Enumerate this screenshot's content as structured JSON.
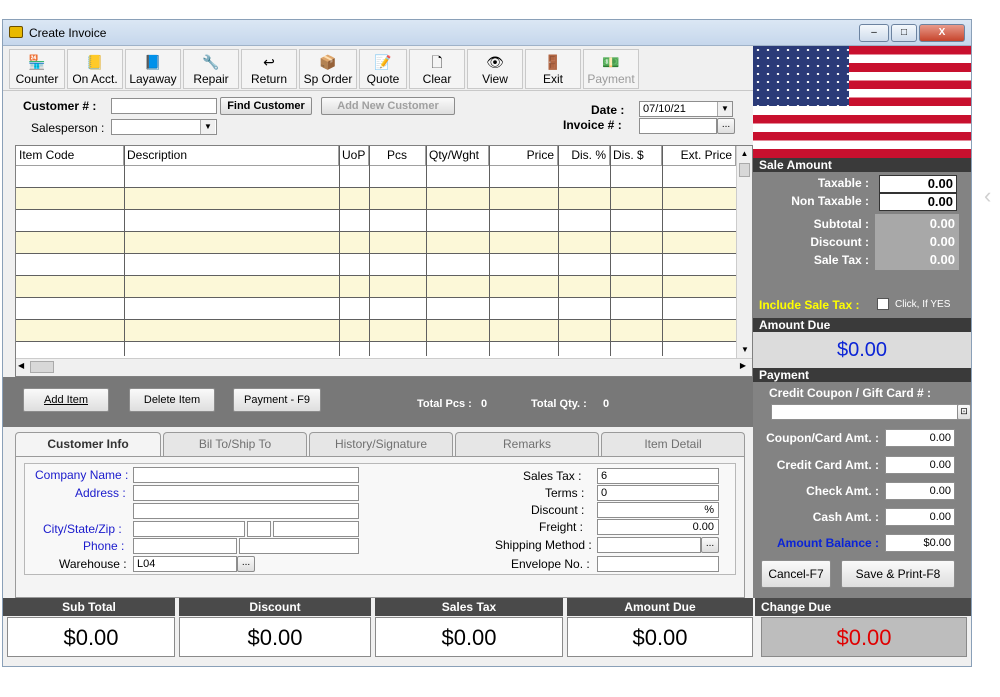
{
  "window": {
    "title": "Create Invoice",
    "min": "–",
    "max": "□",
    "close": "X"
  },
  "toolbar": [
    {
      "label": "Counter",
      "icon": "🏪",
      "name": "counter-button"
    },
    {
      "label": "On Acct.",
      "icon": "📒",
      "name": "on-acct-button"
    },
    {
      "label": "Layaway",
      "icon": "📘",
      "name": "layaway-button"
    },
    {
      "label": "Repair",
      "icon": "🔧",
      "name": "repair-button"
    },
    {
      "label": "Return",
      "icon": "↩",
      "name": "return-button"
    },
    {
      "label": "Sp Order",
      "icon": "📦",
      "name": "sp-order-button"
    },
    {
      "label": "Quote",
      "icon": "📝",
      "name": "quote-button"
    },
    {
      "label": "Clear",
      "icon": "🗋",
      "name": "clear-button"
    },
    {
      "label": "View",
      "icon": "👁",
      "name": "view-button"
    },
    {
      "label": "Exit",
      "icon": "🚪",
      "name": "exit-button"
    },
    {
      "label": "Payment",
      "icon": "💵",
      "name": "payment-toolbar-button"
    }
  ],
  "customer": {
    "label": "Customer # :",
    "value": "",
    "find": "Find Customer",
    "add": "Add New Customer"
  },
  "salesperson": {
    "label": "Salesperson :",
    "value": ""
  },
  "date": {
    "label": "Date :",
    "value": "07/10/21"
  },
  "invoice": {
    "label": "Invoice # :",
    "value": "",
    "browse": "..."
  },
  "grid": {
    "columns": [
      "Item Code",
      "Description",
      "UoP",
      "Pcs",
      "Qty/Wght",
      "Price",
      "Dis. %",
      "Dis. $",
      "Ext. Price"
    ]
  },
  "actions": {
    "add": "Add Item",
    "delete": "Delete Item",
    "payment": "Payment - F9",
    "total_pcs_label": "Total Pcs :",
    "total_pcs": "0",
    "total_qty_label": "Total Qty. :",
    "total_qty": "0"
  },
  "tabs": [
    "Customer Info",
    "Bil To/Ship To",
    "History/Signature",
    "Remarks",
    "Item Detail"
  ],
  "custinfo": {
    "company_label": "Company Name :",
    "address_label": "Address :",
    "city_label": "City/State/Zip :",
    "phone_label": "Phone :",
    "warehouse_label": "Warehouse :",
    "warehouse_value": "L04",
    "browse": "...",
    "sales_tax_label": "Sales Tax :",
    "sales_tax_value": "6",
    "terms_label": "Terms :",
    "terms_value": "0",
    "discount_label": "Discount :",
    "discount_value": "%",
    "freight_label": "Freight :",
    "freight_value": "0.00",
    "shipping_label": "Shipping Method :",
    "envelope_label": "Envelope No. :"
  },
  "sale": {
    "header": "Sale Amount",
    "taxable_label": "Taxable :",
    "taxable": "0.00",
    "nontax_label": "Non Taxable :",
    "nontax": "0.00",
    "subtotal_label": "Subtotal :",
    "subtotal": "0.00",
    "discount_label": "Discount :",
    "discount": "0.00",
    "saletax_label": "Sale Tax :",
    "saletax": "0.00",
    "include_label": "Include Sale Tax :",
    "include_hint": "Click, If YES"
  },
  "amount_due": {
    "header": "Amount Due",
    "value": "$0.00"
  },
  "payment": {
    "header": "Payment",
    "coupon_label": "Credit Coupon / Gift Card # :",
    "coupon_amt_label": "Coupon/Card Amt. :",
    "coupon_amt": "0.00",
    "credit_label": "Credit Card Amt. :",
    "credit": "0.00",
    "check_label": "Check Amt. :",
    "check": "0.00",
    "cash_label": "Cash Amt. :",
    "cash": "0.00",
    "balance_label": "Amount Balance :",
    "balance": "$0.00",
    "cancel": "Cancel-F7",
    "save": "Save & Print-F8"
  },
  "footer": [
    {
      "label": "Sub Total",
      "value": "$0.00"
    },
    {
      "label": "Discount",
      "value": "$0.00"
    },
    {
      "label": "Sales Tax",
      "value": "$0.00"
    },
    {
      "label": "Amount Due",
      "value": "$0.00"
    },
    {
      "label": "Change Due",
      "value": "$0.00"
    }
  ],
  "colors": {
    "change_due": "#e00000",
    "amount_due": "#0b24d6",
    "include_tax": "#ffff00"
  }
}
